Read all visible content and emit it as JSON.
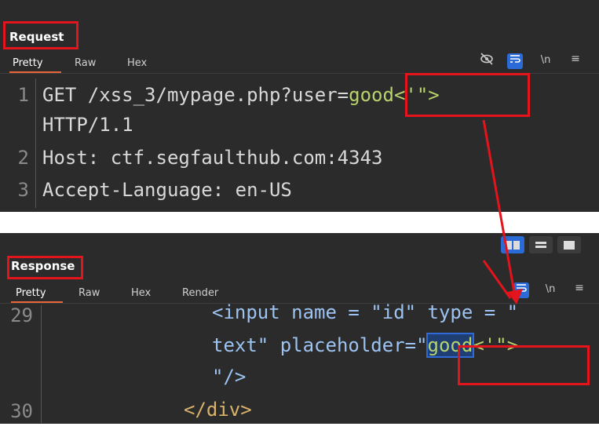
{
  "request": {
    "title": "Request",
    "tabs": [
      "Pretty",
      "Raw",
      "Hex"
    ],
    "icons": [
      "eye-off-icon",
      "wrap-icon",
      "newline-icon",
      "menu-icon"
    ],
    "newline_label": "\\n",
    "lines": [
      {
        "num": "1",
        "parts": [
          {
            "t": "GET /xss_3/mypage.php?user=",
            "c": "plain"
          },
          {
            "t": "good<'\">",
            "c": "green"
          }
        ]
      },
      {
        "num": "",
        "parts": [
          {
            "t": "HTTP/1.1",
            "c": "plain"
          }
        ]
      },
      {
        "num": "2",
        "parts": [
          {
            "t": "Host: ctf.segfaulthub.com:4343",
            "c": "plain"
          }
        ]
      },
      {
        "num": "3",
        "parts": [
          {
            "t": "Accept-Language: en-US",
            "c": "plain"
          }
        ]
      }
    ]
  },
  "response": {
    "title": "Response",
    "tabs": [
      "Pretty",
      "Raw",
      "Hex",
      "Render"
    ],
    "icons": [
      "wrap-icon",
      "newline-icon",
      "menu-icon"
    ],
    "newline_label": "\\n",
    "layout_buttons": [
      "split-vertical-icon",
      "split-horizontal-icon",
      "single-pane-icon"
    ],
    "lines": [
      {
        "num": "29",
        "text_line1": "<input name = \"id\" type = \"",
        "text_line2a": "text\" placeholder=\"",
        "text_highlight": "good",
        "text_line2b": "<'\">",
        "text_line3": "\"/>"
      },
      {
        "num": "30",
        "text": "</div>"
      }
    ]
  },
  "annotation": {
    "color": "#e3141c"
  }
}
